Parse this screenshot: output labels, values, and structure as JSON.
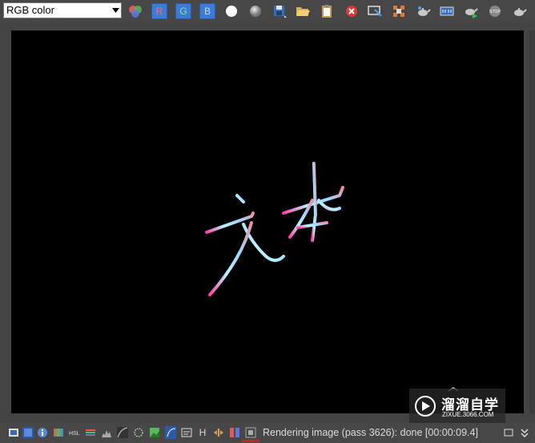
{
  "toolbar": {
    "display_mode": "RGB color",
    "channels": [
      {
        "label": "R",
        "icon": "red-channel-icon"
      },
      {
        "label": "G",
        "icon": "green-channel-icon"
      },
      {
        "label": "B",
        "icon": "blue-channel-icon"
      }
    ],
    "icons": [
      "monochrome-circle-icon",
      "alpha-circle-icon",
      "save-image-icon",
      "open-folder-icon",
      "clipboard-icon",
      "clear-image-icon",
      "track-mouse-icon",
      "region-render-icon",
      "teapot-render-icon",
      "vfb-history-icon",
      "render-teapot-icon",
      "stop-render-icon",
      "render-settings-teapot-icon"
    ]
  },
  "viewport": {
    "render_text": "文本",
    "gradient": [
      "#ff3fa6",
      "#b9f3ff",
      "#9fd6ff",
      "#f28ea0"
    ]
  },
  "statusbar": {
    "icons": [
      "display-corrections-icon",
      "srgb-icon",
      "info-icon",
      "lut-icon",
      "hsl-icon",
      "levels-icon",
      "histogram-icon",
      "curves-icon",
      "lens-effects-icon",
      "background-icon",
      "pixel-aspect-icon",
      "stamp-icon",
      "h-icon",
      "compare-icon",
      "color-clamp-icon",
      "frame-icon"
    ],
    "h_label": "H",
    "message": "Rendering image (pass 3626): done [00:00:09.4]"
  },
  "watermark": {
    "title": "溜溜自学",
    "subtitle": "ZIXUE.3066.COM"
  }
}
